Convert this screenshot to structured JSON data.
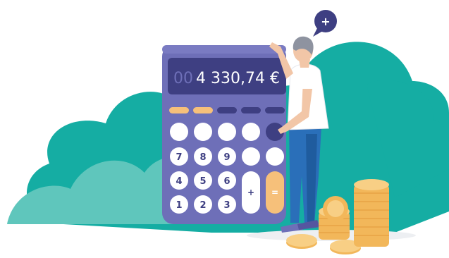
{
  "calculator": {
    "display_prefix": "00",
    "display_value": "4 330,74 €",
    "keys": {
      "k7": "7",
      "k8": "8",
      "k9": "9",
      "k4": "4",
      "k5": "5",
      "k6": "6",
      "k1": "1",
      "k2": "2",
      "k3": "3",
      "plus": "+",
      "equals": "="
    }
  },
  "speech_bubble": {
    "label": "+"
  },
  "colors": {
    "teal": "#15ADA3",
    "light_teal": "#5FC6BC",
    "calculator_body": "#6E6FB8",
    "display_bg": "#3E3F82",
    "key_orange": "#F6C07A",
    "key_dark": "#3E3F82",
    "shirt": "#FFFFFF",
    "pants": "#2A6FB9",
    "coin": "#F2B75A"
  }
}
